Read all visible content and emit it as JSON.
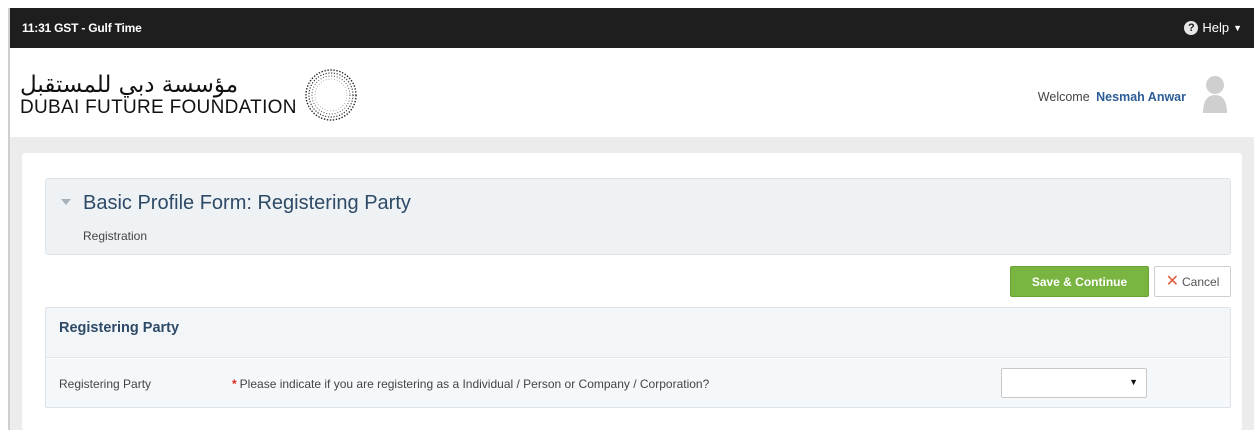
{
  "topbar": {
    "time": "11:31 GST - Gulf Time",
    "help_label": "Help",
    "help_icon": "question-circle-icon",
    "caret_icon": "caret-down-icon"
  },
  "header": {
    "logo_arabic": "مؤسسة دبي للمستقبل",
    "logo_english": "DUBAI FUTURE FOUNDATION",
    "welcome_text": "Welcome",
    "user_name": "Nesmah Anwar",
    "avatar_icon": "user-silhouette-icon"
  },
  "form": {
    "title": "Basic Profile Form: Registering Party",
    "subtitle": "Registration",
    "save_label": "Save & Continue",
    "cancel_label": "Cancel",
    "section_title": "Registering Party",
    "field_label": "Registering Party",
    "question": "Please indicate if you are registering as a Individual / Person or Company / Corporation?",
    "required_mark": "*",
    "select_value": ""
  },
  "colors": {
    "topbar_bg": "#1e1e1e",
    "accent_green": "#79b540",
    "title_blue": "#2e4a66",
    "username_blue": "#2d5d97",
    "required_red": "#e0251b"
  }
}
